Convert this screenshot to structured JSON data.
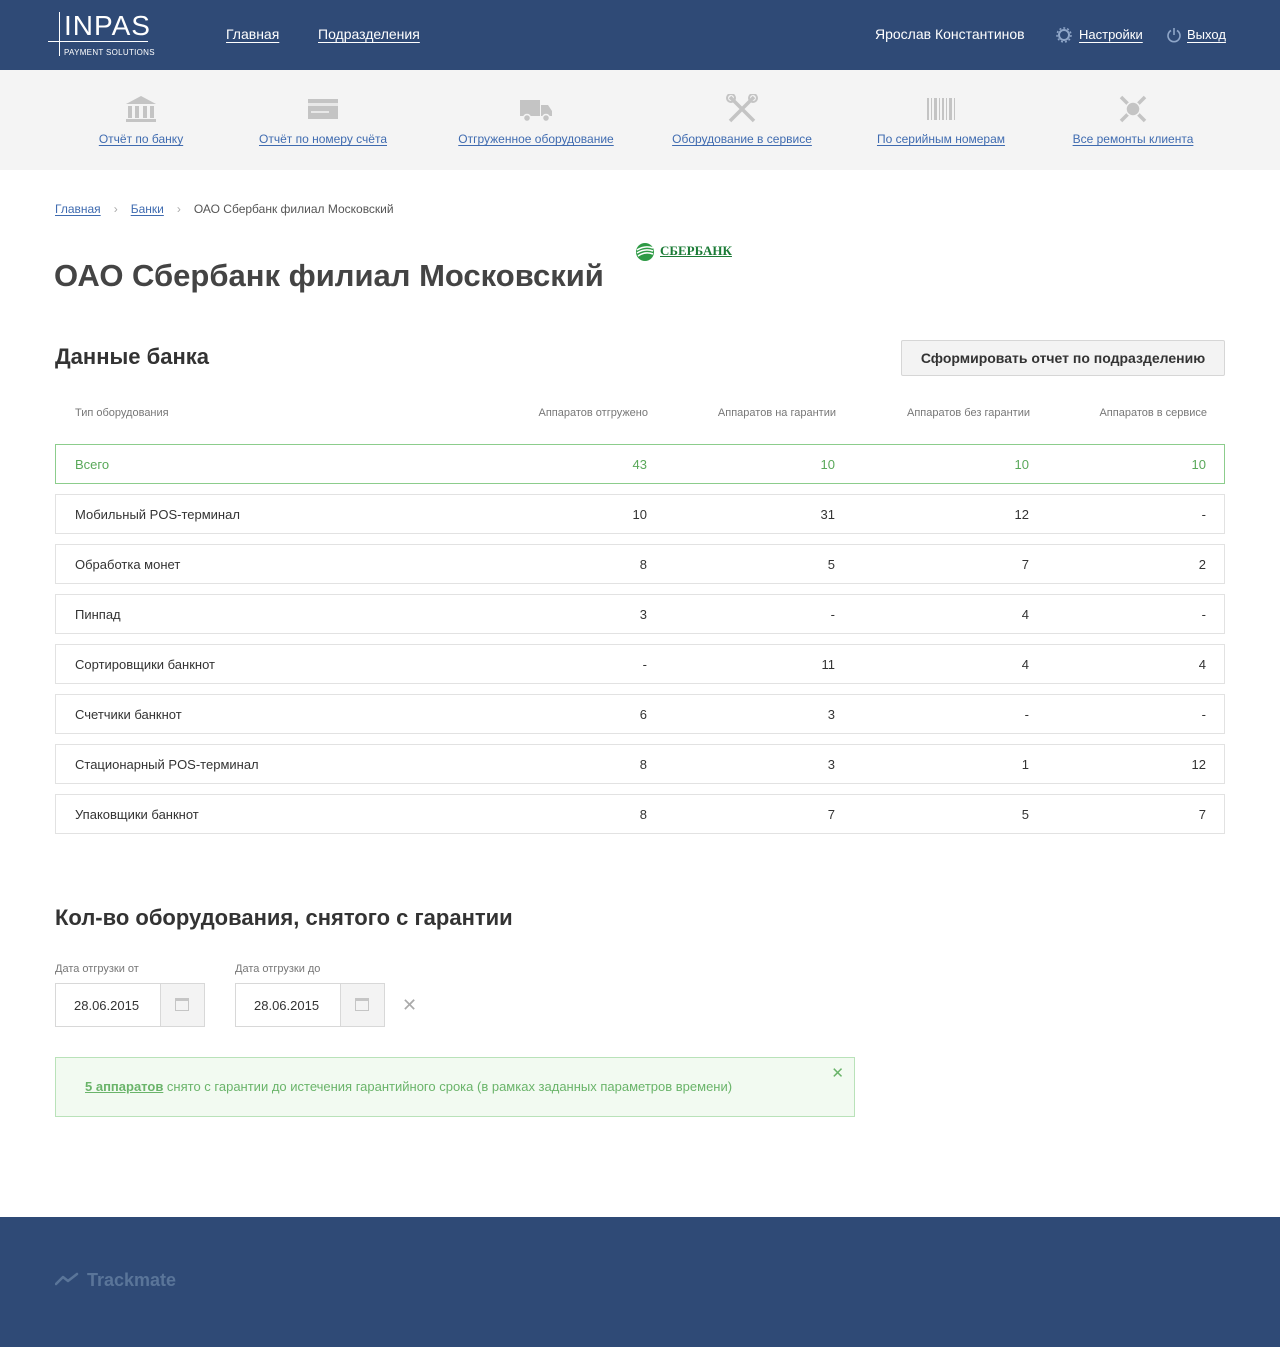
{
  "header": {
    "logo_text": "INPAS",
    "logo_sub": "PAYMENT SOLUTIONS",
    "nav": [
      "Главная",
      "Подразделения"
    ],
    "user_name": "Ярослав Константинов",
    "settings_label": "Настройки",
    "logout_label": "Выход"
  },
  "quickbar": [
    {
      "label": "Отчёт по банку",
      "icon": "bank-icon"
    },
    {
      "label": "Отчёт по номеру счёта",
      "icon": "card-icon"
    },
    {
      "label": "Отгруженное оборудование",
      "icon": "truck-icon"
    },
    {
      "label": "Оборудование в сервисе",
      "icon": "tools-icon"
    },
    {
      "label": "По серийным номерам",
      "icon": "barcode-icon"
    },
    {
      "label": "Все ремонты клиента",
      "icon": "repair-icon"
    }
  ],
  "breadcrumbs": {
    "items": [
      "Главная",
      "Банки"
    ],
    "current": "ОАО Сбербанк филиал Московский"
  },
  "page_title": "ОАО Сбербанк филиал Московский",
  "bank_logo_text": "СБЕРБАНК",
  "bank_section": {
    "title": "Данные банка",
    "report_button": "Сформировать отчет по подразделению",
    "columns": [
      "Тип оборудования",
      "Аппаратов отгружено",
      "Аппаратов на гарантии",
      "Аппаратов без гарантии",
      "Аппаратов в сервисе"
    ],
    "rows": [
      [
        "Всего",
        "43",
        "10",
        "10",
        "10"
      ],
      [
        "Мобильный POS-терминал",
        "10",
        "31",
        "12",
        "-"
      ],
      [
        "Обработка монет",
        "8",
        "5",
        "7",
        "2"
      ],
      [
        "Пинпад",
        "3",
        "-",
        "4",
        "-"
      ],
      [
        "Сортировщики банкнот",
        "-",
        "11",
        "4",
        "4"
      ],
      [
        "Счетчики банкнот",
        "6",
        "3",
        "-",
        "-"
      ],
      [
        "Стационарный POS-терминал",
        "8",
        "3",
        "1",
        "12"
      ],
      [
        "Упаковщики банкнот",
        "8",
        "7",
        "5",
        "7"
      ]
    ]
  },
  "warranty_section": {
    "title": "Кол-во оборудования, снятого с гарантии",
    "from_label": "Дата отгрузки от",
    "from_value": "28.06.2015",
    "to_label": "Дата отгрузки до",
    "to_value": "28.06.2015",
    "clear_symbol": "✕",
    "alert_strong": "5 аппаратов",
    "alert_text": " снято с гарантии до истечения гарантийного срока (в рамках заданных параметров времени)",
    "alert_close": "✕"
  },
  "footer": {
    "brand": "Trackmate"
  },
  "colors": {
    "header_bg": "#2f4a76",
    "link": "#3f6bb0",
    "success": "#6ab46a"
  }
}
